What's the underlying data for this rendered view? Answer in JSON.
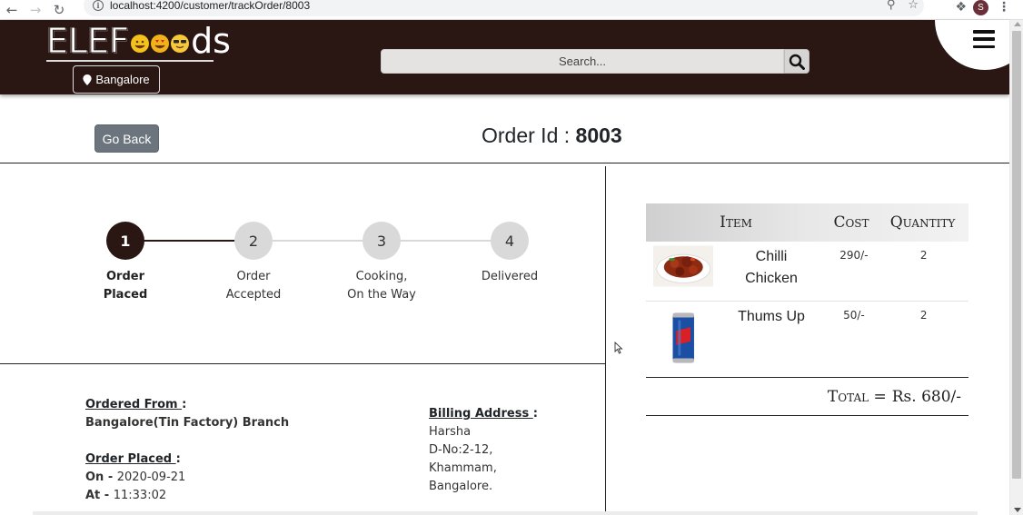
{
  "browser": {
    "url": "localhost:4200/customer/trackOrder/8003",
    "profile_initial": "S"
  },
  "header": {
    "logo_prefix": "ELEF",
    "logo_suffix": "ds",
    "location": "Bangalore",
    "search_placeholder": "Search..."
  },
  "order": {
    "go_back_label": "Go Back",
    "id_label": "Order Id : ",
    "id_value": "8003"
  },
  "tracker": {
    "steps": [
      {
        "number": "1",
        "line1": "Order",
        "line2": "Placed",
        "active": true
      },
      {
        "number": "2",
        "line1": "Order",
        "line2": "Accepted",
        "active": false
      },
      {
        "number": "3",
        "line1": "Cooking,",
        "line2": "On the Way",
        "active": false
      },
      {
        "number": "4",
        "line1": "Delivered",
        "line2": "",
        "active": false
      }
    ]
  },
  "details": {
    "ordered_from_label": "Ordered From ",
    "ordered_from_value": "Bangalore(Tin Factory) Branch",
    "order_placed_label": "Order Placed ",
    "on_label": "On - ",
    "on_value": "2020-09-21",
    "at_label": "At - ",
    "at_value": "11:33:02",
    "billing_label": "Billing Address ",
    "billing_lines": [
      "Harsha",
      "D-No:2-12,",
      "Khammam,",
      "Bangalore."
    ]
  },
  "items_table": {
    "headers": {
      "item": "Item",
      "cost": "Cost",
      "quantity": "Quantity"
    },
    "rows": [
      {
        "name_line1": "Chilli",
        "name_line2": "Chicken",
        "cost": "290/-",
        "qty": "2"
      },
      {
        "name_line1": "Thums Up",
        "name_line2": "",
        "cost": "50/-",
        "qty": "2"
      }
    ],
    "total_label": "Total = ",
    "total_value": "Rs. 680/-"
  },
  "colors": {
    "header_bg": "#2a1612",
    "active_step": "#2a1612",
    "inactive_step": "#d9d9d9",
    "go_back_bg": "#6c757d"
  }
}
